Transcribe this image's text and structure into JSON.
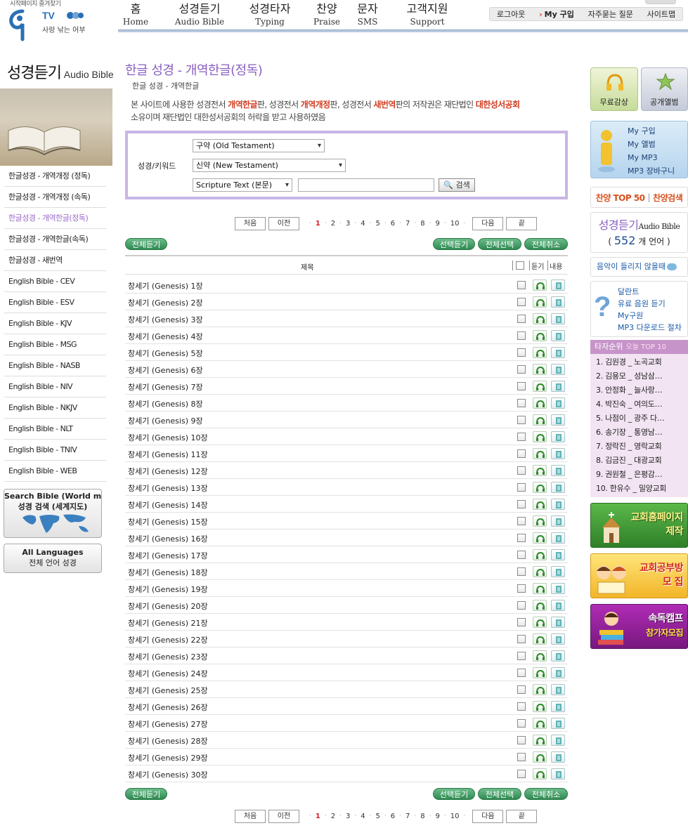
{
  "header": {
    "top_util": "시작페이지   즐겨찾기",
    "logo_tv": "TV",
    "logo_slogan": "사랑 낚는 어부",
    "gnb": [
      {
        "k": "홈",
        "e": "Home"
      },
      {
        "k": "성경듣기",
        "e": "Audio Bible"
      },
      {
        "k": "성경타자",
        "e": "Typing"
      },
      {
        "k": "찬양",
        "e": "Praise"
      },
      {
        "k": "문자",
        "e": "SMS"
      },
      {
        "k": "고객지원",
        "e": "Support"
      }
    ],
    "util": {
      "logout": "로그아웃",
      "my_buy": "My 구입",
      "faq": "자주묻는 질문",
      "sitemap": "사이트맵"
    }
  },
  "left": {
    "title_k": "성경듣기",
    "title_e": "Audio Bible",
    "menu": [
      "한글성경 - 개역개정 (정독)",
      "한글성경 - 개역개정 (속독)",
      "한글성경 - 개역한글(정독)",
      "한글성경 - 개역한글(속독)",
      "한글성경 - 새번역",
      "English  Bible - CEV",
      "English  Bible - ESV",
      "English  Bible - KJV",
      "English  Bible - MSG",
      "English  Bible - NASB",
      "English  Bible - NIV",
      "English  Bible - NKJV",
      "English  Bible - NLT",
      "English  Bible - TNIV",
      "English  Bible - WEB"
    ],
    "active_index": 2,
    "btn_map_l1": "Search Bible (World map)",
    "btn_map_l2": "성경 검색 (세계지도)",
    "btn_lang_l1": "All Languages",
    "btn_lang_l2": "전체 언어 성경"
  },
  "main": {
    "title": "한글 성경 - 개역한글(정독)",
    "sub": "한글 성경 - 개역한글",
    "notice": {
      "p1": "본 사이트에 사용한 성경전서 ",
      "b1": "개역한글",
      "p2": "판, 성경전서 ",
      "b2": "개역개정",
      "p3": "판, 성경전서 ",
      "b3": "새번역",
      "p4": "판의 저작권은 재단법인 ",
      "b4": "대한성서공회",
      "line2": "소유이며 재단법인 대한성서공회의 허락을 받고 사용하였음"
    },
    "search": {
      "label": "성경/키워드",
      "ot": "구약 (Old Testament)",
      "nt": "신약 (New Testament)",
      "type": "Scripture Text (본문)",
      "keyword": "",
      "button": "검색"
    },
    "pager": {
      "first": "처음",
      "prev": "이전",
      "pages": [
        "1",
        "2",
        "3",
        "4",
        "5",
        "6",
        "7",
        "8",
        "9",
        "10"
      ],
      "current": "1",
      "next": "다음",
      "last": "끝"
    },
    "actions": {
      "listen_all": "전체듣기",
      "listen_selected": "선택듣기",
      "select_all": "전체선택",
      "cancel_all": "전체취소"
    },
    "list_head": {
      "title": "제목",
      "listen": "듣기",
      "content": "내용"
    },
    "rows": [
      "창세기 (Genesis) 1장",
      "창세기 (Genesis) 2장",
      "창세기 (Genesis) 3장",
      "창세기 (Genesis) 4장",
      "창세기 (Genesis) 5장",
      "창세기 (Genesis) 6장",
      "창세기 (Genesis) 7장",
      "창세기 (Genesis) 8장",
      "창세기 (Genesis) 9장",
      "창세기 (Genesis) 10장",
      "창세기 (Genesis) 11장",
      "창세기 (Genesis) 12장",
      "창세기 (Genesis) 13장",
      "창세기 (Genesis) 14장",
      "창세기 (Genesis) 15장",
      "창세기 (Genesis) 16장",
      "창세기 (Genesis) 17장",
      "창세기 (Genesis) 18장",
      "창세기 (Genesis) 19장",
      "창세기 (Genesis) 20장",
      "창세기 (Genesis) 21장",
      "창세기 (Genesis) 22장",
      "창세기 (Genesis) 23장",
      "창세기 (Genesis) 24장",
      "창세기 (Genesis) 25장",
      "창세기 (Genesis) 26장",
      "창세기 (Genesis) 27장",
      "창세기 (Genesis) 28장",
      "창세기 (Genesis) 29장",
      "창세기 (Genesis) 30장"
    ]
  },
  "right": {
    "free_listen": "무료감상",
    "public_album": "공개앨범",
    "my_menu": [
      "My 구입",
      "My 앨범",
      "My MP3",
      "MP3 장바구니"
    ],
    "hymn_top": "찬양 TOP 50",
    "hymn_search": "찬양검색",
    "audio_title_k": "성경듣기",
    "audio_title_e": "Audio Bible",
    "lang_open": "(",
    "lang_count": "552",
    "lang_suffix": "개 언어 )",
    "no_audio": "음악이 들리지 않을때",
    "faq_links": [
      "달란트",
      "유료 음원 듣기",
      "My구원",
      "MP3 다운로드 절차"
    ],
    "rank_title": "타자순위",
    "rank_sub": "오늘 TOP 10",
    "rank": [
      "1. 김원경 _ 노곡교회",
      "2. 김용모 _ 성남삼…",
      "3. 안정화 _ 늘사랑…",
      "4. 박진숙 _ 여의도…",
      "5. 나점이 _ 광주 다…",
      "6. 송기장 _ 통영남…",
      "7. 정락진 _ 영락교회",
      "8. 김금진 _ 대광교회",
      "9. 권원철 _ 은평감…",
      "10. 한유수 _ 밀양교회"
    ],
    "banner_church_1": "교회홈페이지",
    "banner_church_2": "제작",
    "banner_study_1": "교회공부방",
    "banner_study_2": "모 집",
    "banner_camp_1": "속독캠프",
    "banner_camp_2": "참가자모집"
  },
  "colors": {
    "accent_purple": "#8a5fc0",
    "highlight_red": "#d23c20",
    "button_green": "#2f8a52",
    "search_border": "#c8b6e6"
  }
}
